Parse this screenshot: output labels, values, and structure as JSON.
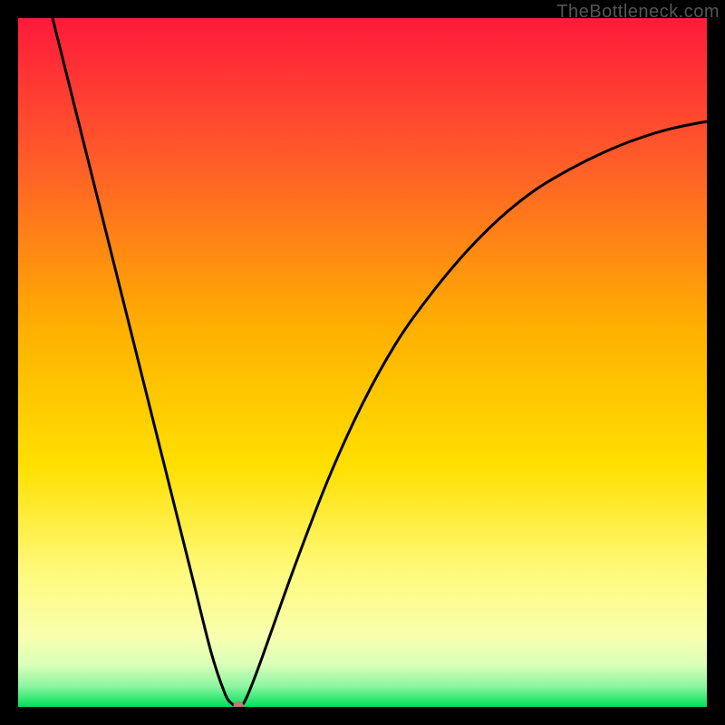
{
  "watermark": "TheBottleneck.com",
  "chart_data": {
    "type": "line",
    "title": "",
    "xlabel": "",
    "ylabel": "",
    "xlim": [
      0,
      100
    ],
    "ylim": [
      0,
      100
    ],
    "series": [
      {
        "name": "curve",
        "x": [
          5,
          10,
          15,
          20,
          25,
          28,
          30,
          31,
          32,
          33,
          35,
          40,
          45,
          50,
          55,
          60,
          65,
          70,
          75,
          80,
          85,
          90,
          95,
          100
        ],
        "y": [
          100,
          80,
          60,
          40,
          20,
          8,
          2,
          0.5,
          0,
          1,
          6,
          20,
          33,
          44,
          53,
          60,
          66,
          71,
          75,
          78,
          80.5,
          82.5,
          84,
          85
        ]
      }
    ],
    "marker": {
      "x": 32,
      "y": 0,
      "color": "#c97570",
      "radius": 6
    },
    "gradient_stops": [
      {
        "offset": 0.0,
        "color": "#ff1a3a"
      },
      {
        "offset": 0.2,
        "color": "#ff5a2a"
      },
      {
        "offset": 0.45,
        "color": "#ffb000"
      },
      {
        "offset": 0.65,
        "color": "#ffe000"
      },
      {
        "offset": 0.8,
        "color": "#fff97a"
      },
      {
        "offset": 0.9,
        "color": "#f7ffb0"
      },
      {
        "offset": 0.94,
        "color": "#d8ffb8"
      },
      {
        "offset": 0.97,
        "color": "#8cf5a0"
      },
      {
        "offset": 1.0,
        "color": "#00e05a"
      }
    ]
  }
}
